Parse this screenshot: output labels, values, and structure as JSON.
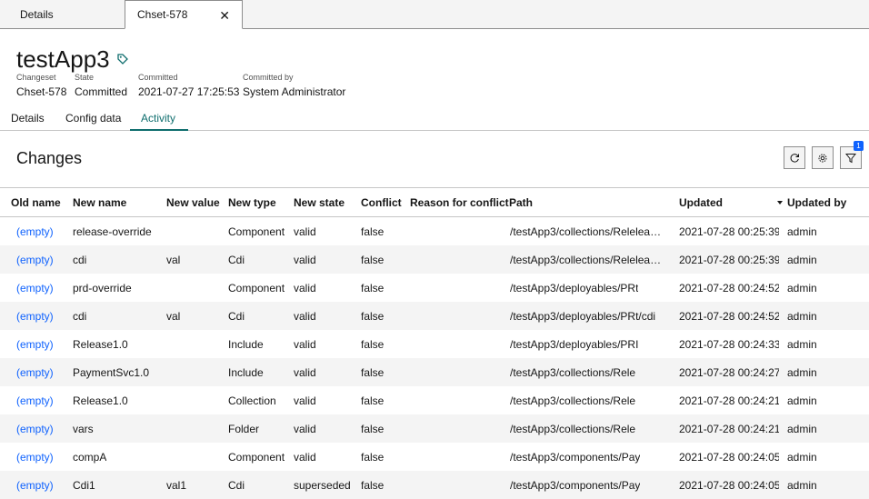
{
  "tabs": [
    {
      "label": "Details"
    },
    {
      "label": "Chset-578"
    }
  ],
  "header": {
    "title": "testApp3",
    "meta": [
      {
        "label": "Changeset",
        "value": "Chset-578"
      },
      {
        "label": "State",
        "value": "Committed"
      },
      {
        "label": "Committed",
        "value": "2021-07-27 17:25:53"
      },
      {
        "label": "Committed by",
        "value": "System Administrator"
      }
    ]
  },
  "subtabs": [
    {
      "label": "Details"
    },
    {
      "label": "Config data"
    },
    {
      "label": "Activity",
      "active": true
    }
  ],
  "changes": {
    "title": "Changes",
    "filter_count": "1"
  },
  "table": {
    "columns": [
      "Old name",
      "New name",
      "New value",
      "New type",
      "New state",
      "Conflict",
      "Reason for conflict",
      "Path",
      "Updated",
      "Updated by"
    ],
    "rows": [
      [
        "(empty)",
        "release-override",
        "",
        "Component",
        "valid",
        "false",
        "",
        "/testApp3/collections/Relelea…",
        "2021-07-28 00:25:39",
        "admin"
      ],
      [
        "(empty)",
        "cdi",
        "val",
        "Cdi",
        "valid",
        "false",
        "",
        "/testApp3/collections/Relelea…",
        "2021-07-28 00:25:39",
        "admin"
      ],
      [
        "(empty)",
        "prd-override",
        "",
        "Component",
        "valid",
        "false",
        "",
        "/testApp3/deployables/PRt",
        "2021-07-28 00:24:52",
        "admin"
      ],
      [
        "(empty)",
        "cdi",
        "val",
        "Cdi",
        "valid",
        "false",
        "",
        "/testApp3/deployables/PRt/cdi",
        "2021-07-28 00:24:52",
        "admin"
      ],
      [
        "(empty)",
        "Release1.0",
        "",
        "Include",
        "valid",
        "false",
        "",
        "/testApp3/deployables/PRI",
        "2021-07-28 00:24:33",
        "admin"
      ],
      [
        "(empty)",
        "PaymentSvc1.0",
        "",
        "Include",
        "valid",
        "false",
        "",
        "/testApp3/collections/Rele",
        "2021-07-28 00:24:27",
        "admin"
      ],
      [
        "(empty)",
        "Release1.0",
        "",
        "Collection",
        "valid",
        "false",
        "",
        "/testApp3/collections/Rele",
        "2021-07-28 00:24:21",
        "admin"
      ],
      [
        "(empty)",
        "vars",
        "",
        "Folder",
        "valid",
        "false",
        "",
        "/testApp3/collections/Rele",
        "2021-07-28 00:24:21",
        "admin"
      ],
      [
        "(empty)",
        "compA",
        "",
        "Component",
        "valid",
        "false",
        "",
        "/testApp3/components/Pay",
        "2021-07-28 00:24:05",
        "admin"
      ],
      [
        "(empty)",
        "Cdi1",
        "val1",
        "Cdi",
        "superseded",
        "false",
        "",
        "/testApp3/components/Pay",
        "2021-07-28 00:24:05",
        "admin"
      ]
    ]
  },
  "colors": {
    "accent": "#0f6e6e",
    "link": "#0f62fe"
  }
}
